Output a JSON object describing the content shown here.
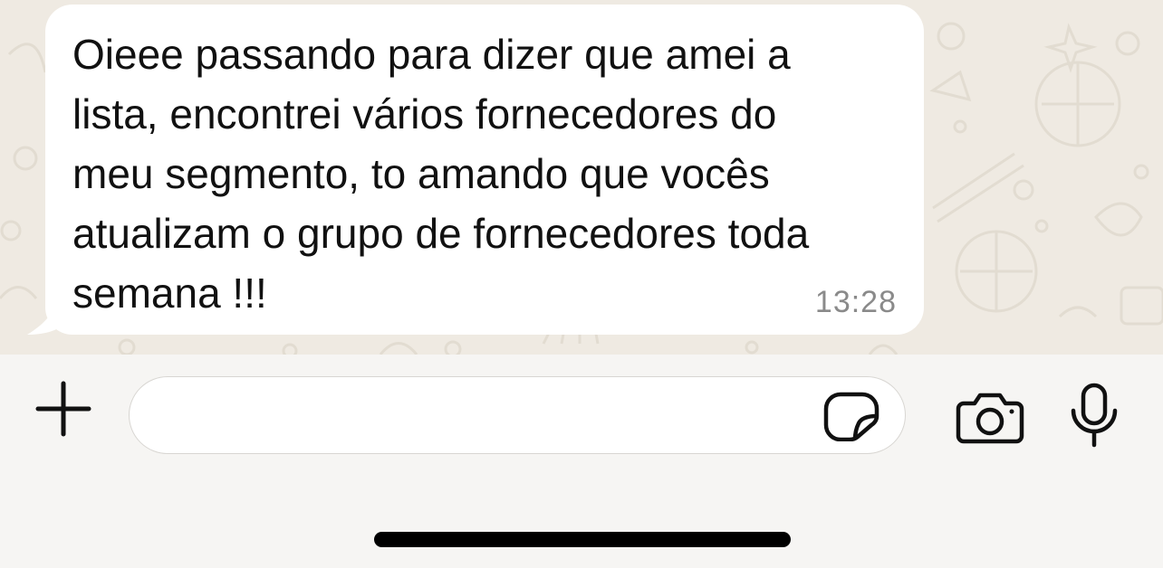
{
  "chat": {
    "message": {
      "text": "Oieee passando para dizer que amei a\nlista, encontrei vários fornecedores do\nmeu segmento, to amando que vocês\natualizam o grupo de fornecedores toda\nsemana !!!",
      "time": "13:28",
      "bubble_color": "#ffffff"
    },
    "wallpaper_color": "#efeae2"
  },
  "composer": {
    "input_value": "",
    "icons": {
      "attach": "plus-icon",
      "sticker": "sticker-icon",
      "camera": "camera-icon",
      "mic": "microphone-icon"
    }
  }
}
